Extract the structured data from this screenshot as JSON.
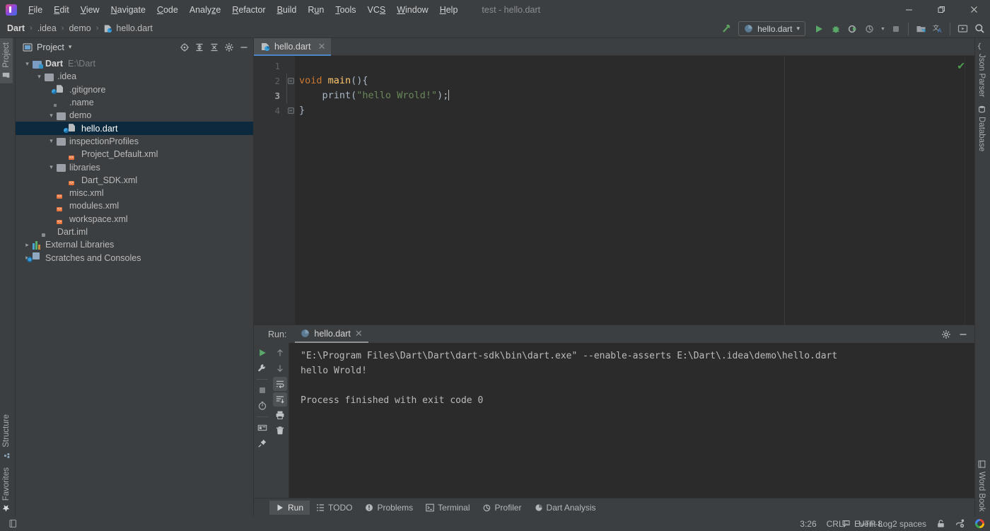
{
  "window": {
    "title": "test - hello.dart",
    "minimize_label": "—",
    "maximize_label": "❐",
    "close_label": "✕"
  },
  "menu": {
    "items": [
      {
        "label": "File",
        "mnemonic": "F"
      },
      {
        "label": "Edit",
        "mnemonic": "E"
      },
      {
        "label": "View",
        "mnemonic": "V"
      },
      {
        "label": "Navigate",
        "mnemonic": "N"
      },
      {
        "label": "Code",
        "mnemonic": "C"
      },
      {
        "label": "Analyze",
        "mnemonic": "z"
      },
      {
        "label": "Refactor",
        "mnemonic": "R"
      },
      {
        "label": "Build",
        "mnemonic": "B"
      },
      {
        "label": "Run",
        "mnemonic": "u"
      },
      {
        "label": "Tools",
        "mnemonic": "T"
      },
      {
        "label": "VCS",
        "mnemonic": "S"
      },
      {
        "label": "Window",
        "mnemonic": "W"
      },
      {
        "label": "Help",
        "mnemonic": "H"
      }
    ]
  },
  "breadcrumb": {
    "items": [
      "Dart",
      ".idea",
      "demo",
      "hello.dart"
    ],
    "separator": "›"
  },
  "main_toolbar": {
    "run_config_label": "hello.dart",
    "dropdown_caret": "▾",
    "icons": [
      "build-icon",
      "run-icon",
      "debug-icon",
      "run-with-coverage-icon",
      "profile-icon",
      "stop-icon",
      "open-in-device-manager-icon",
      "translate-icon",
      "presentation-icon",
      "search-everywhere-icon"
    ]
  },
  "left_stripe": {
    "top_tabs": [
      {
        "label": "Project",
        "icon": "project-folder-icon",
        "active": true
      }
    ],
    "bottom_tabs": [
      {
        "label": "Structure",
        "icon": "structure-icon"
      },
      {
        "label": "Favorites",
        "icon": "star-icon"
      }
    ]
  },
  "right_stripe": {
    "top_tabs": [
      {
        "label": "Json Parser",
        "icon": "json-parser-icon"
      },
      {
        "label": "Database",
        "icon": "database-icon"
      }
    ],
    "bottom_tabs": [
      {
        "label": "Word Book",
        "icon": "word-book-icon"
      }
    ]
  },
  "project_panel": {
    "title": "Project",
    "dropdown_caret": "▾",
    "toolbar_icons": [
      "locate-icon",
      "expand-all-icon",
      "collapse-all-icon",
      "settings-gear-icon",
      "hide-icon"
    ],
    "tree": [
      {
        "label": "Dart",
        "secondary": "E:\\Dart",
        "icon": "module-folder-icon",
        "depth": 0,
        "expanded": true,
        "bold": true,
        "selected": false
      },
      {
        "label": ".idea",
        "icon": "folder-icon",
        "depth": 1,
        "expanded": true,
        "selected": false
      },
      {
        "label": ".gitignore",
        "icon": "dart-file-icon",
        "depth": 2,
        "selected": false
      },
      {
        "label": ".name",
        "icon": "file-icon",
        "depth": 2,
        "selected": false
      },
      {
        "label": "demo",
        "icon": "folder-icon",
        "depth": 2,
        "expanded": true,
        "selected": false
      },
      {
        "label": "hello.dart",
        "icon": "dart-file-icon",
        "depth": 3,
        "selected": true
      },
      {
        "label": "inspectionProfiles",
        "icon": "folder-icon",
        "depth": 2,
        "expanded": true,
        "selected": false
      },
      {
        "label": "Project_Default.xml",
        "icon": "xml-file-icon",
        "depth": 3,
        "selected": false
      },
      {
        "label": "libraries",
        "icon": "folder-icon",
        "depth": 2,
        "expanded": true,
        "selected": false
      },
      {
        "label": "Dart_SDK.xml",
        "icon": "xml-file-icon",
        "depth": 3,
        "selected": false
      },
      {
        "label": "misc.xml",
        "icon": "xml-file-icon",
        "depth": 2,
        "selected": false
      },
      {
        "label": "modules.xml",
        "icon": "xml-file-icon",
        "depth": 2,
        "selected": false
      },
      {
        "label": "workspace.xml",
        "icon": "xml-file-icon",
        "depth": 2,
        "selected": false
      },
      {
        "label": "Dart.iml",
        "icon": "iml-file-icon",
        "depth": 1,
        "selected": false
      },
      {
        "label": "External Libraries",
        "icon": "external-libraries-icon",
        "depth": 0,
        "expanded": false,
        "collapsed": true,
        "selected": false
      },
      {
        "label": "Scratches and Consoles",
        "icon": "scratches-icon",
        "depth": 0,
        "expanded": false,
        "collapsed": true,
        "selected": false
      }
    ]
  },
  "editor": {
    "tabs": [
      {
        "label": "hello.dart",
        "icon": "dart-file-icon",
        "close_label": "✕",
        "active": true
      }
    ],
    "gutter_lines": [
      "1",
      "2",
      "3",
      "4"
    ],
    "current_line": 3,
    "inspection_status": "✔",
    "code_lines": [
      {
        "n": 1,
        "tokens": []
      },
      {
        "n": 2,
        "fold": "minus",
        "tokens": [
          {
            "t": "void",
            "c": "k-kw"
          },
          {
            "t": " ",
            "c": "k-plain"
          },
          {
            "t": "main",
            "c": "k-fn"
          },
          {
            "t": "(){",
            "c": "k-plain"
          }
        ]
      },
      {
        "n": 3,
        "tokens": [
          {
            "t": "    print",
            "c": "k-plain"
          },
          {
            "t": "(",
            "c": "k-plain"
          },
          {
            "t": "\"hello Wrold!\"",
            "c": "k-str"
          },
          {
            "t": ");",
            "c": "k-plain"
          }
        ],
        "caret": true
      },
      {
        "n": 4,
        "fold": "minus",
        "tokens": [
          {
            "t": "}",
            "c": "k-plain"
          }
        ]
      }
    ]
  },
  "run_panel": {
    "label": "Run:",
    "tab_label": "hello.dart",
    "tab_close": "✕",
    "header_icons": [
      "settings-gear-icon",
      "hide-icon"
    ],
    "left_tool_icons": [
      "rerun-icon",
      "edit-configuration-icon",
      "stop-icon",
      "timer-icon",
      "layout-icon",
      "pin-icon"
    ],
    "second_tool_icons": [
      "up-arrow-icon",
      "down-arrow-icon",
      "soft-wrap-icon",
      "scroll-to-end-icon",
      "print-icon",
      "clear-all-icon"
    ],
    "console_lines": [
      "\"E:\\Program Files\\Dart\\Dart\\dart-sdk\\bin\\dart.exe\" --enable-asserts E:\\Dart\\.idea\\demo\\hello.dart",
      "hello Wrold!",
      "",
      "Process finished with exit code 0"
    ]
  },
  "bottom_bar": {
    "tabs": [
      {
        "label": "Run",
        "icon": "run-icon",
        "active": true
      },
      {
        "label": "TODO",
        "icon": "todo-icon",
        "active": false
      },
      {
        "label": "Problems",
        "icon": "problems-icon",
        "active": false
      },
      {
        "label": "Terminal",
        "icon": "terminal-icon",
        "active": false
      },
      {
        "label": "Profiler",
        "icon": "profiler-icon",
        "active": false
      },
      {
        "label": "Dart Analysis",
        "icon": "dart-analysis-icon",
        "active": false
      }
    ]
  },
  "status_bar": {
    "event_log": "Event Log",
    "caret_position": "3:26",
    "line_separator": "CRLF",
    "encoding": "UTF-8",
    "indent": "2 spaces",
    "icons": [
      "lock-icon",
      "branch-icon",
      "google-logo-icon"
    ]
  },
  "colors": {
    "background": "#3c3f41",
    "editor_background": "#2b2b2b",
    "gutter_background": "#313335",
    "selection": "#0d293e",
    "accent_tab": "#4a88c7",
    "keyword": "#cc7832",
    "function": "#ffc66d",
    "string": "#6a8759",
    "plain_code": "#a9b7c6",
    "run_green": "#59a869"
  }
}
